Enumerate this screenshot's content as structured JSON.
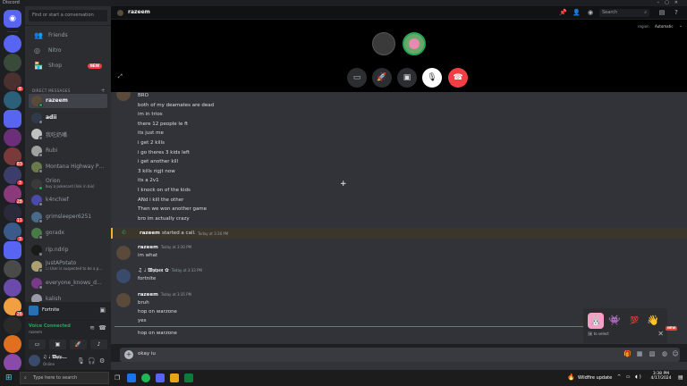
{
  "window": {
    "title": "Discord"
  },
  "servers": [
    {
      "color": "#5865f2"
    },
    {
      "color": "#3a4a3a"
    },
    {
      "color": "#4b3030",
      "badge": "8"
    },
    {
      "color": "#2c5f7a"
    },
    {
      "color": "#5865f2"
    },
    {
      "color": "#6b2f7a"
    },
    {
      "color": "#7a3a3a",
      "badge": "83"
    },
    {
      "color": "#3d3d6b",
      "badge": "3"
    },
    {
      "color": "#8a3a7a",
      "badge": "28"
    },
    {
      "color": "#2a2a3a",
      "badge": "11"
    },
    {
      "color": "#3a5a8a",
      "badge": "3"
    },
    {
      "color": "#5865f2"
    },
    {
      "color": "#4a4a4a"
    },
    {
      "color": "#6a4aaa"
    },
    {
      "color": "#f0a040",
      "badge": "26"
    },
    {
      "color": "#2a2a2a"
    },
    {
      "color": "#e07020"
    },
    {
      "color": "#8a4aaa"
    }
  ],
  "sidebar": {
    "search_placeholder": "Find or start a conversation",
    "nav": [
      {
        "label": "Friends",
        "icon": "👥"
      },
      {
        "label": "Nitro",
        "icon": "◎"
      },
      {
        "label": "Shop",
        "icon": "🏪",
        "badge": "NEW"
      }
    ],
    "dm_header": "DIRECT MESSAGES",
    "dms": [
      {
        "name": "razeem",
        "active": true,
        "color": "#5a4a3a",
        "status": "#23a55a"
      },
      {
        "name": "adii",
        "bright": true,
        "color": "#2f3a4a",
        "status": "#80848e"
      },
      {
        "name": "我吃奶嘴",
        "color": "#c0c0c0",
        "status": "#80848e"
      },
      {
        "name": "Rubi",
        "color": "#a0a0a0",
        "status": "#80848e"
      },
      {
        "name": "Montana Highway Pat...",
        "color": "#6a7a4a",
        "status": "#80848e"
      },
      {
        "name": "Orion",
        "sub": "buy a pokecard (link in bio)",
        "color": "#3a3a3a",
        "status": "#23a55a"
      },
      {
        "name": "k4nchief",
        "color": "#4a4aaa",
        "status": "#80848e"
      },
      {
        "name": "grimsleeper6251",
        "color": "#4a6a8a",
        "status": "#80848e"
      },
      {
        "name": "goradx",
        "color": "#4a7a4a",
        "status": "#80848e"
      },
      {
        "name": "rip.ndrip",
        "color": "#1a1a1a",
        "status": "#80848e"
      },
      {
        "name": "JustAPotato",
        "sub": "☐ User is suspected to be a p...",
        "color": "#aaa070",
        "status": "#80848e"
      },
      {
        "name": "everyone_knows_dylan",
        "color": "#7a3a8a",
        "status": "#80848e"
      },
      {
        "name": "kalish",
        "color": "#9a9aaa",
        "status": "#80848e"
      },
      {
        "name": "Ozzie2z",
        "color": "#7a4a3a",
        "status": "#80848e"
      }
    ],
    "activity": "Fortnite",
    "voice": {
      "title": "Voice Connected",
      "sub": "razeem"
    },
    "user": {
      "name": "♫ ♩ 𝔚𝔶𝔯𝔭...",
      "status": "Online"
    }
  },
  "topbar": {
    "channel": "razeem",
    "search_placeholder": "Search",
    "region_label": "region",
    "region_value": "Automatic"
  },
  "messages_top": [
    "BRO",
    "both of my deamates are dead",
    "im in trios",
    "there 12 people le ft",
    "its just me",
    "i get 2 kills",
    "i go theres 3 kids left",
    "i get another kill",
    "3 kills rigjt now",
    "its a 2v1",
    "I knock on of the kids",
    "ANd i kill the other",
    "Then we won another game",
    "bro im actually crazy"
  ],
  "call_event": {
    "author": "razeem",
    "text": "started a call.",
    "time": "Today at 3:30 PM"
  },
  "groups": [
    {
      "author": "razeem",
      "time": "Today at 3:30 PM",
      "lines": [
        "im what"
      ],
      "color": "#5a4a3a"
    },
    {
      "author": "♫ ♩ 𝔚𝔶𝔯𝔭𝔢𝔫 ✿",
      "time": "Today at 3:33 PM",
      "lines": [
        "fortnite"
      ],
      "color": "#3a4a6a"
    },
    {
      "author": "razeem",
      "time": "Today at 3:35 PM",
      "lines": [
        "bruh",
        "hop on warzone",
        "yes"
      ],
      "color": "#5a4a3a"
    }
  ],
  "last_message": "hop on warzone",
  "composer": {
    "value": "okay iu",
    "placeholder": "Message @razeem"
  },
  "sticker_picker": {
    "hint": "to select",
    "tab_key": "⇥",
    "new_label": "NEW"
  },
  "taskbar": {
    "search_placeholder": "Type here to search",
    "weather": "Wildfire update",
    "time": "3:38 PM",
    "date": "4/17/2024"
  }
}
